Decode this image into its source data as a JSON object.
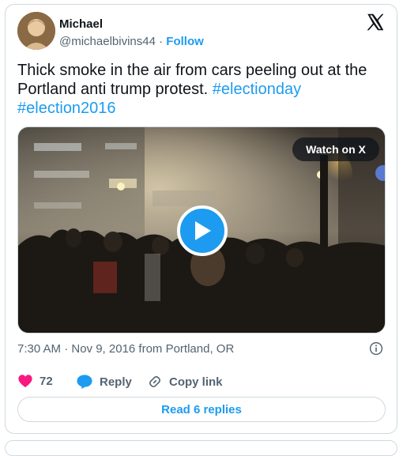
{
  "author": {
    "name": "Michael",
    "handle": "@michaelbivins44",
    "separator": " · ",
    "follow_label": "Follow"
  },
  "tweet": {
    "text": "Thick smoke in the air from cars peeling out at the Portland anti trump protest. ",
    "hashtags": [
      "#electionday",
      "#election2016"
    ]
  },
  "media": {
    "watch_label": "Watch on X",
    "play_icon": "play-icon"
  },
  "meta": {
    "timestamp": "7:30 AM · Nov 9, 2016 from Portland, OR"
  },
  "actions": {
    "likes": "72",
    "reply_label": "Reply",
    "copy_label": "Copy link"
  },
  "read_replies": "Read 6 replies",
  "colors": {
    "accent": "#1d9bf0",
    "like": "#f91880",
    "text": "#0f1419",
    "muted": "#536471"
  }
}
